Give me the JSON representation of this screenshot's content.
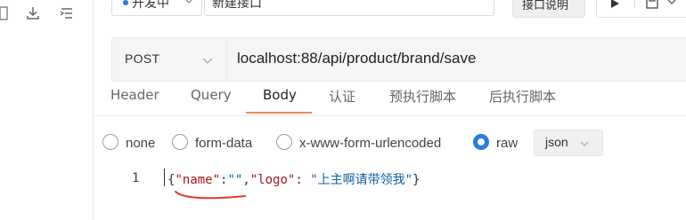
{
  "left_rail": {
    "icons": [
      "panel-icon",
      "download-icon",
      "list-icon"
    ]
  },
  "top_bar": {
    "environment": "开发中",
    "name_value": "新建接口",
    "doc_button": "接口说明",
    "run_icon": "play-icon",
    "save_icon": "save-icon"
  },
  "request": {
    "method": "POST",
    "url": "localhost:88/api/product/brand/save"
  },
  "tabs": [
    "Header",
    "Query",
    "Body",
    "认证",
    "预执行脚本",
    "后执行脚本"
  ],
  "active_tab": "Body",
  "body_types": [
    {
      "label": "none",
      "checked": false
    },
    {
      "label": "form-data",
      "checked": false
    },
    {
      "label": "x-www-form-urlencoded",
      "checked": false
    },
    {
      "label": "raw",
      "checked": true
    }
  ],
  "format": "json",
  "editor": {
    "line_number": "1",
    "tokens": {
      "open": "{",
      "key1": "\"name\"",
      "colon1": ":",
      "val1": "\"\"",
      "comma": ",",
      "key2": "\"logo\"",
      "colon2": ": ",
      "val2": "\"上主啊请带领我\"",
      "close": "}"
    }
  },
  "colors": {
    "accent_blue": "#2a7ae2",
    "tab_underline": "#f08a5d",
    "annotation_red": "#e03a2a"
  }
}
